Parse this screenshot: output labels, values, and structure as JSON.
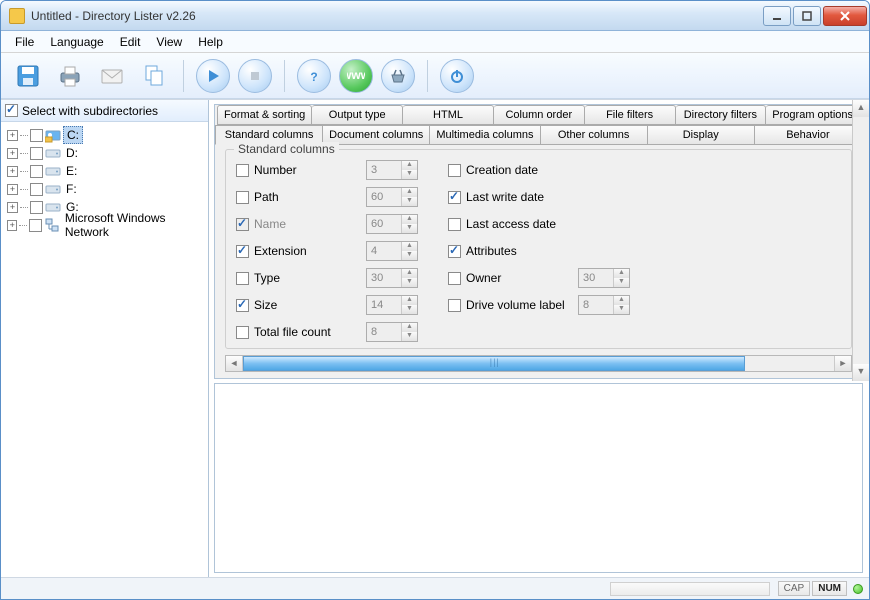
{
  "title": "Untitled - Directory Lister v2.26",
  "menu": {
    "file": "File",
    "language": "Language",
    "edit": "Edit",
    "view": "View",
    "help": "Help"
  },
  "sidebar": {
    "header_label": "Select with subdirectories",
    "header_checked": true,
    "items": [
      {
        "label": "C:",
        "checked": false,
        "selected": true,
        "kind": "drive-c"
      },
      {
        "label": "D:",
        "checked": false,
        "selected": false,
        "kind": "drive"
      },
      {
        "label": "E:",
        "checked": false,
        "selected": false,
        "kind": "drive"
      },
      {
        "label": "F:",
        "checked": false,
        "selected": false,
        "kind": "drive"
      },
      {
        "label": "G:",
        "checked": false,
        "selected": false,
        "kind": "drive"
      },
      {
        "label": "Microsoft Windows Network",
        "checked": false,
        "selected": false,
        "kind": "network"
      }
    ]
  },
  "tabs_row1": [
    "Format & sorting",
    "Output type",
    "HTML",
    "Column order",
    "File filters",
    "Directory filters",
    "Program options"
  ],
  "tabs_row2": [
    "Standard columns",
    "Document columns",
    "Multimedia columns",
    "Other columns",
    "Display",
    "Behavior"
  ],
  "active_tab": "Standard columns",
  "groupbox_title": "Standard columns",
  "columns_left": [
    {
      "label": "Number",
      "checked": false,
      "spin": "3",
      "disabled": false
    },
    {
      "label": "Path",
      "checked": false,
      "spin": "60",
      "disabled": false
    },
    {
      "label": "Name",
      "checked": true,
      "spin": "60",
      "disabled": true
    },
    {
      "label": "Extension",
      "checked": true,
      "spin": "4",
      "disabled": false
    },
    {
      "label": "Type",
      "checked": false,
      "spin": "30",
      "disabled": false
    },
    {
      "label": "Size",
      "checked": true,
      "spin": "14",
      "disabled": false
    },
    {
      "label": "Total file count",
      "checked": false,
      "spin": "8",
      "disabled": false
    }
  ],
  "columns_right": [
    {
      "label": "Creation date",
      "checked": false,
      "spin": null
    },
    {
      "label": "Last write date",
      "checked": true,
      "spin": null
    },
    {
      "label": "Last access date",
      "checked": false,
      "spin": null
    },
    {
      "label": "Attributes",
      "checked": true,
      "spin": null
    },
    {
      "label": "Owner",
      "checked": false,
      "spin": "30"
    },
    {
      "label": "Drive volume label",
      "checked": false,
      "spin": "8"
    }
  ],
  "status": {
    "cap": "CAP",
    "num": "NUM"
  }
}
